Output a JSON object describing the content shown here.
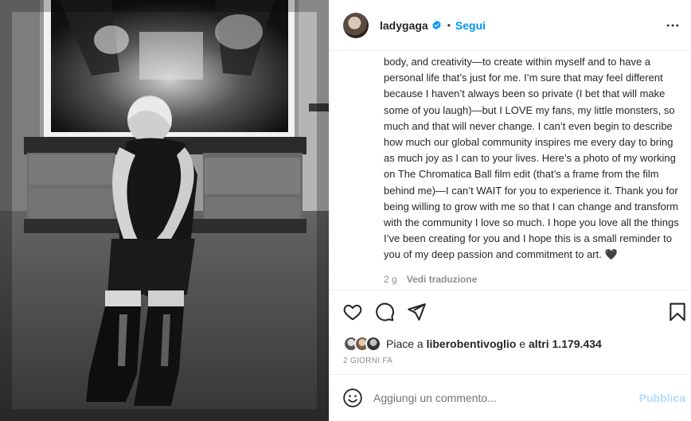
{
  "post": {
    "username": "ladygaga",
    "separator": "•",
    "follow_label": "Segui",
    "caption": "body, and creativity—to create within myself and to have a personal life that’s just for me. I’m sure that may feel different because I haven’t always been so private (I bet that will make some of you laugh)—but I LOVE my fans, my little monsters, so much and that will never change. I can’t even begin to describe how much our global community inspires me every day to bring as much joy as I can to your lives. Here’s a photo of my working on The Chromatica Ball film edit (that’s a frame from the film behind me)—I can’t WAIT for you to experience it. Thank you for being willing to grow with me so that I can change and transform with the community I love so much. I hope you love all the things I’ve been creating for you and I hope this is a small reminder to you of my deep passion and commitment to art. 🖤",
    "time_ago": "2 g",
    "translate_label": "Vedi traduzione",
    "likes_prefix": "Piace a ",
    "likes_user": "liberobentivoglio",
    "likes_middle": " e ",
    "likes_count": "altri 1.179.434",
    "date": "2 GIORNI FA",
    "comment_placeholder": "Aggiungi un commento...",
    "publish_label": "Pubblica"
  },
  "icons": {
    "verified": "verified-badge-icon",
    "more": "more-options-icon",
    "like": "heart-icon",
    "comment": "comment-bubble-icon",
    "share": "paper-plane-icon",
    "save": "bookmark-icon",
    "emoji": "smiley-icon"
  },
  "colors": {
    "accent": "#0095f6",
    "publish_disabled": "#b3dbff",
    "muted": "#8e8e8e"
  }
}
